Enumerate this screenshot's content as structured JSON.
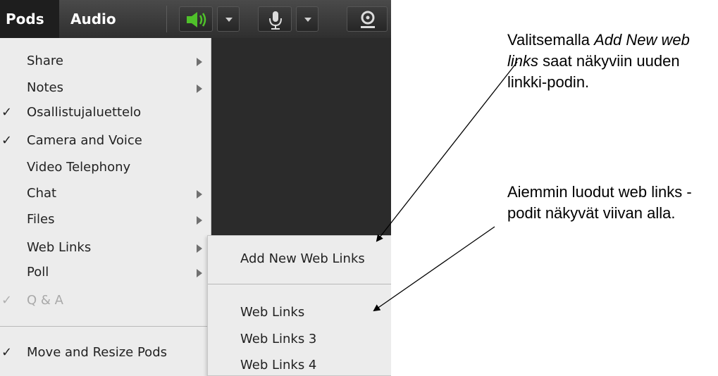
{
  "menubar": {
    "pods_label": "Pods",
    "audio_label": "Audio",
    "speaker_icon": "speaker-icon",
    "mic_icon": "microphone-icon",
    "camera_icon": "webcam-icon"
  },
  "pods_menu": {
    "items": [
      {
        "label": "Share",
        "checked": false,
        "submenu": true
      },
      {
        "label": "Notes",
        "checked": false,
        "submenu": true
      },
      {
        "label": "Osallistujaluettelo",
        "checked": true,
        "submenu": false
      },
      {
        "label": "Camera and Voice",
        "checked": true,
        "submenu": false
      },
      {
        "label": "Video Telephony",
        "checked": false,
        "submenu": false
      },
      {
        "label": "Chat",
        "checked": false,
        "submenu": true
      },
      {
        "label": "Files",
        "checked": false,
        "submenu": true
      },
      {
        "label": "Web Links",
        "checked": false,
        "submenu": true
      },
      {
        "label": "Poll",
        "checked": false,
        "submenu": true
      },
      {
        "label": "Q & A",
        "checked": true,
        "submenu": false,
        "disabled": true
      },
      {
        "label": "Move and Resize Pods",
        "checked": true,
        "submenu": false
      }
    ],
    "check_mark": "✓"
  },
  "weblinks_submenu": {
    "add_new": "Add New Web Links",
    "items": [
      "Web Links",
      "Web Links 3",
      "Web Links 4"
    ]
  },
  "annotations": {
    "note1_pre": "Valitsemalla ",
    "note1_italic": "Add New web links",
    "note1_post": " saat näkyviin uuden linkki-podin.",
    "note2": "Aiemmin luodut web links -podit näkyvät viivan alla."
  },
  "colors": {
    "menubar_bg": "#3a3a3a",
    "menu_bg": "#ececec",
    "speaker_green": "#4fc12a",
    "pod_dark": "#2b2b2b"
  }
}
